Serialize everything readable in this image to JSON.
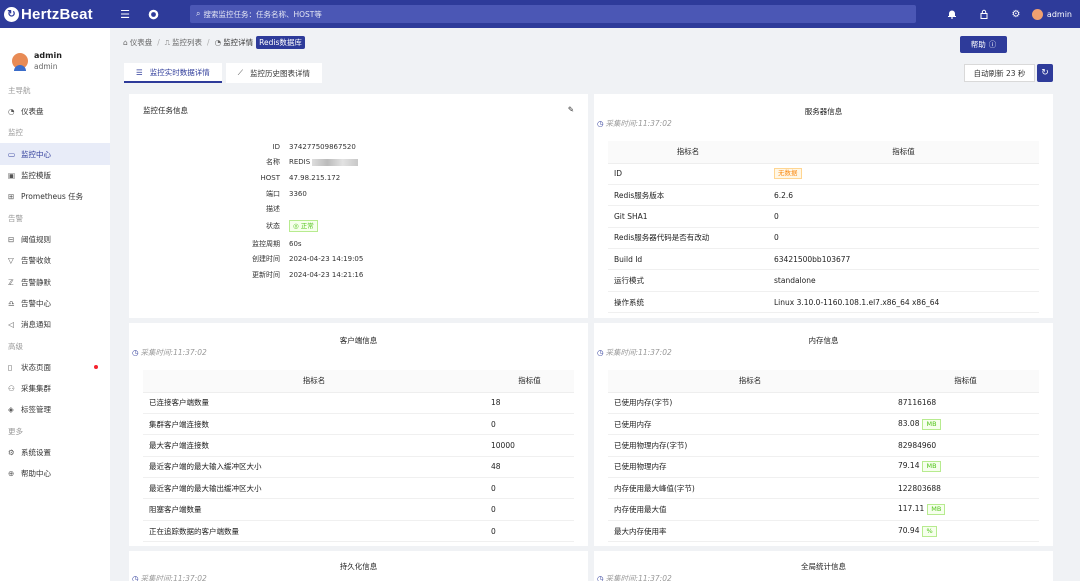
{
  "app": {
    "logo": "HertzBeat",
    "search_placeholder": "搜索监控任务：任务名称、HOST等",
    "user": "admin"
  },
  "user": {
    "name": "admin",
    "role": "admin"
  },
  "nav": {
    "g_main": "主导航",
    "dashboard": "仪表盘",
    "g_monitor": "监控",
    "monitor_center": "监控中心",
    "monitor_template": "监控模版",
    "prometheus": "Prometheus 任务",
    "g_alert": "告警",
    "threshold": "阈值规则",
    "converge": "告警收敛",
    "silence": "告警静默",
    "alert_center": "告警中心",
    "notice": "消息通知",
    "g_advanced": "高级",
    "status_page": "状态页面",
    "collector": "采集集群",
    "tags": "标签管理",
    "g_more": "更多",
    "settings": "系统设置",
    "help_center": "帮助中心"
  },
  "breadcrumb": {
    "home": "仪表盘",
    "list": "监控列表",
    "detail": "监控详情",
    "tag": "Redis数据库"
  },
  "help_label": "帮助",
  "tabs": {
    "realtime": "监控实时数据详情",
    "history": "监控历史图表详情"
  },
  "refresh_label": "自动刷新 23 秒",
  "info": {
    "title": "监控任务信息",
    "labels": {
      "id": "ID",
      "name": "名称",
      "host": "HOST",
      "port": "端口",
      "desc": "描述",
      "status": "状态",
      "interval": "监控周期",
      "created": "创建时间",
      "updated": "更新时间"
    },
    "values": {
      "id": "374277509867520",
      "name": "REDIS",
      "host": "47.98.215.172",
      "port": "3360",
      "desc": "",
      "status": "正常",
      "interval": "60s",
      "created": "2024-04-23 14:19:05",
      "updated": "2024-04-23 14:21:16"
    }
  },
  "collect_time": "采集时间:11:37:02",
  "col_name": "指标名",
  "col_value": "指标值",
  "server": {
    "title": "服务器信息",
    "no_data": "无数据",
    "rows": [
      {
        "k": "ID",
        "v": ""
      },
      {
        "k": "Redis服务版本",
        "v": "6.2.6"
      },
      {
        "k": "Git SHA1",
        "v": "0"
      },
      {
        "k": "Redis服务器代码是否有改动",
        "v": "0"
      },
      {
        "k": "Build Id",
        "v": "63421500bb103677"
      },
      {
        "k": "运行模式",
        "v": "standalone"
      },
      {
        "k": "操作系统",
        "v": "Linux 3.10.0-1160.108.1.el7.x86_64 x86_64"
      }
    ]
  },
  "client": {
    "title": "客户端信息",
    "rows": [
      {
        "k": "已连接客户端数量",
        "v": "18"
      },
      {
        "k": "集群客户端连接数",
        "v": "0"
      },
      {
        "k": "最大客户端连接数",
        "v": "10000"
      },
      {
        "k": "最近客户端的最大输入缓冲区大小",
        "v": "48"
      },
      {
        "k": "最近客户端的最大输出缓冲区大小",
        "v": "0"
      },
      {
        "k": "阻塞客户端数量",
        "v": "0"
      },
      {
        "k": "正在追踪数据的客户端数量",
        "v": "0"
      }
    ]
  },
  "memory": {
    "title": "内存信息",
    "rows": [
      {
        "k": "已使用内存(字节)",
        "v": "87116168",
        "u": ""
      },
      {
        "k": "已使用内存",
        "v": "83.08",
        "u": "MB"
      },
      {
        "k": "已使用物理内存(字节)",
        "v": "82984960",
        "u": ""
      },
      {
        "k": "已使用物理内存",
        "v": "79.14",
        "u": "MB"
      },
      {
        "k": "内存使用最大峰值(字节)",
        "v": "122803688",
        "u": ""
      },
      {
        "k": "内存使用最大值",
        "v": "117.11",
        "u": "MB"
      },
      {
        "k": "最大内存使用率",
        "v": "70.94",
        "u": "%"
      }
    ]
  },
  "persist": {
    "title": "持久化信息"
  },
  "global": {
    "title": "全局统计信息"
  }
}
